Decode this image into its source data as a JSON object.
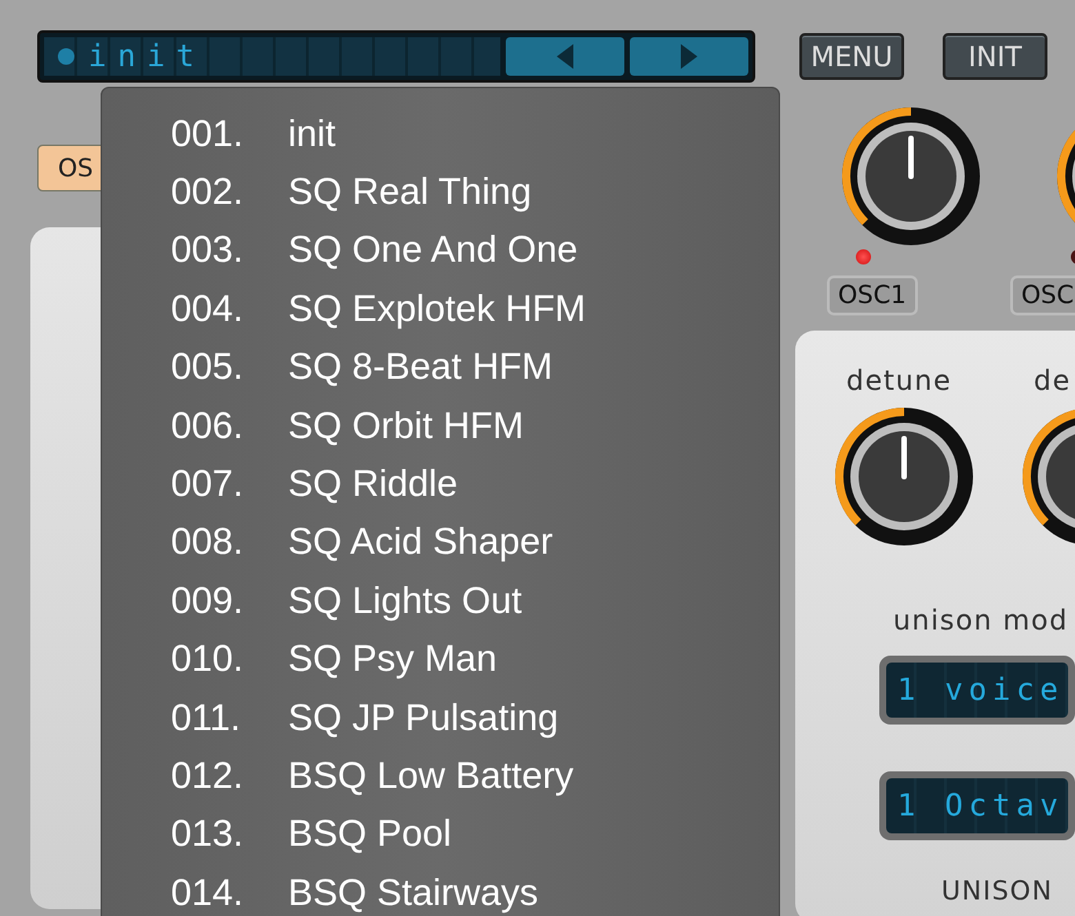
{
  "preset_bar": {
    "name": "init"
  },
  "header_buttons": [
    {
      "label": "MENU"
    },
    {
      "label": "INIT"
    }
  ],
  "osc_tab": {
    "label": "OS"
  },
  "oscillators": [
    {
      "label": "OSC1",
      "level": 0.5,
      "on": true
    },
    {
      "label": "OSC",
      "level": 0.5,
      "on": false
    }
  ],
  "unison": {
    "title": "UNISON",
    "knobs": [
      {
        "label": "detune",
        "level": 0.5
      },
      {
        "label": "de",
        "level": 0.5
      }
    ],
    "mode_label": "unison mod",
    "displays": [
      "1 voice",
      "1 Octav"
    ]
  },
  "preset_menu": [
    {
      "number": "001.",
      "name": "init"
    },
    {
      "number": "002.",
      "name": "SQ Real Thing"
    },
    {
      "number": "003.",
      "name": "SQ One And One"
    },
    {
      "number": "004.",
      "name": "SQ Explotek HFM"
    },
    {
      "number": "005.",
      "name": "SQ 8-Beat HFM"
    },
    {
      "number": "006.",
      "name": "SQ Orbit HFM"
    },
    {
      "number": "007.",
      "name": "SQ Riddle"
    },
    {
      "number": "008.",
      "name": "SQ Acid Shaper"
    },
    {
      "number": "009.",
      "name": "SQ Lights Out"
    },
    {
      "number": "010.",
      "name": "SQ Psy Man"
    },
    {
      "number": "011.",
      "name": "SQ JP Pulsating"
    },
    {
      "number": "012.",
      "name": "BSQ Low Battery"
    },
    {
      "number": "013.",
      "name": "BSQ Pool"
    },
    {
      "number": "014.",
      "name": "BSQ Stairways"
    }
  ]
}
